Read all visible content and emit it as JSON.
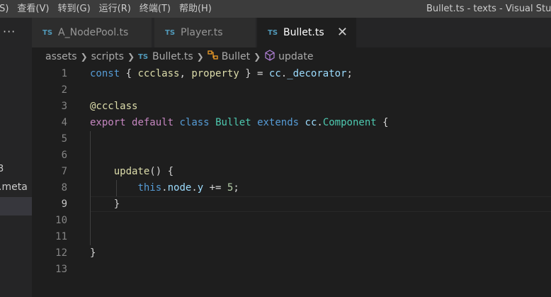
{
  "menu": {
    "items": [
      "(S)",
      "查看(V)",
      "转到(G)",
      "运行(R)",
      "终端(T)",
      "帮助(H)"
    ]
  },
  "window_title": "Bullet.ts - texts - Visual Studi",
  "sidebar": {
    "more_label": "···",
    "fragment1": "3",
    "fragment2": ".meta"
  },
  "tabs": [
    {
      "icon": "TS",
      "label": "A_NodePool.ts",
      "active": false
    },
    {
      "icon": "TS",
      "label": "Player.ts",
      "active": false
    },
    {
      "icon": "TS",
      "label": "Bullet.ts",
      "active": true,
      "close": "✕"
    }
  ],
  "breadcrumb": {
    "parts": [
      "assets",
      "scripts",
      "Bullet.ts",
      "Bullet",
      "update"
    ],
    "file_icon": "TS",
    "class_icon": "class-icon",
    "method_icon": "method-cube-icon"
  },
  "editor": {
    "line_numbers": [
      "1",
      "2",
      "3",
      "4",
      "5",
      "6",
      "7",
      "8",
      "9",
      "10",
      "11",
      "12",
      "13"
    ],
    "current_line": 9,
    "lines": [
      "const { ccclass, property } = cc._decorator;",
      "",
      "@ccclass",
      "export default class Bullet extends cc.Component {",
      "",
      "",
      "    update() {",
      "        this.node.y += 5;",
      "    }",
      "",
      "",
      "}",
      ""
    ]
  },
  "colors": {
    "keyword": "#569cd6",
    "control_keyword": "#c586c0",
    "function": "#dcdcaa",
    "type": "#4ec9b0",
    "variable": "#9cdcfe",
    "number": "#b5cea8",
    "ts_icon": "#519aba"
  }
}
